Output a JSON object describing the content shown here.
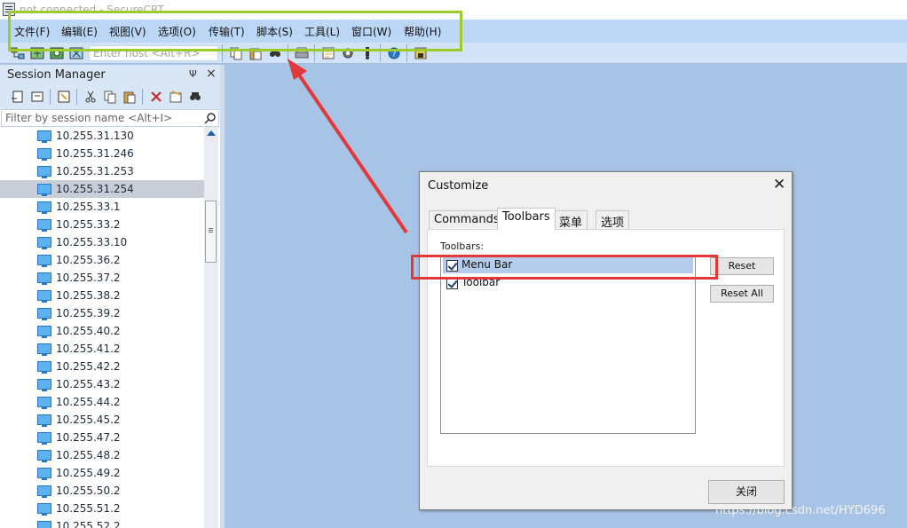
{
  "window": {
    "title": "not connected - SecureCRT"
  },
  "menubar": {
    "items": [
      {
        "label": "文件(F)"
      },
      {
        "label": "编辑(E)"
      },
      {
        "label": "视图(V)"
      },
      {
        "label": "选项(O)"
      },
      {
        "label": "传输(T)"
      },
      {
        "label": "脚本(S)"
      },
      {
        "label": "工具(L)"
      },
      {
        "label": "窗口(W)"
      },
      {
        "label": "帮助(H)"
      }
    ]
  },
  "toolbar": {
    "host_placeholder": "Enter host <Alt+R>"
  },
  "session_manager": {
    "title": "Session Manager",
    "pin_label": "Ψ",
    "close_label": "×",
    "filter_placeholder": "Filter by session name <Alt+I>",
    "sessions": [
      {
        "label": "10.255.31.130"
      },
      {
        "label": "10.255.31.246"
      },
      {
        "label": "10.255.31.253"
      },
      {
        "label": "10.255.31.254",
        "selected": true
      },
      {
        "label": "10.255.33.1"
      },
      {
        "label": "10.255.33.2"
      },
      {
        "label": "10.255.33.10"
      },
      {
        "label": "10.255.36.2"
      },
      {
        "label": "10.255.37.2"
      },
      {
        "label": "10.255.38.2"
      },
      {
        "label": "10.255.39.2"
      },
      {
        "label": "10.255.40.2"
      },
      {
        "label": "10.255.41.2"
      },
      {
        "label": "10.255.42.2"
      },
      {
        "label": "10.255.43.2"
      },
      {
        "label": "10.255.44.2"
      },
      {
        "label": "10.255.45.2"
      },
      {
        "label": "10.255.47.2"
      },
      {
        "label": "10.255.48.2"
      },
      {
        "label": "10.255.49.2"
      },
      {
        "label": "10.255.50.2"
      },
      {
        "label": "10.255.51.2"
      },
      {
        "label": "10.255.52.2"
      }
    ]
  },
  "dialog": {
    "title": "Customize",
    "close_label": "✕",
    "tabs": [
      {
        "label": "Commands"
      },
      {
        "label": "Toolbars",
        "active": true
      },
      {
        "label": "菜单"
      },
      {
        "label": "选项"
      }
    ],
    "group_label": "Toolbars:",
    "toolbars": [
      {
        "label": "Menu Bar",
        "checked": true,
        "selected": true
      },
      {
        "label": "Toolbar",
        "checked": true
      }
    ],
    "reset_label": "Reset",
    "reset_all_label": "Reset All",
    "close_button_label": "关闭"
  },
  "watermark": "https://blog.csdn.net/HYD696",
  "colors": {
    "menubar_bg": "#bcd6f5",
    "workspace_bg": "#a7c3e6",
    "highlight_green": "#9ccc2c",
    "highlight_red": "#e23a3a",
    "selection": "#b5ccec"
  }
}
